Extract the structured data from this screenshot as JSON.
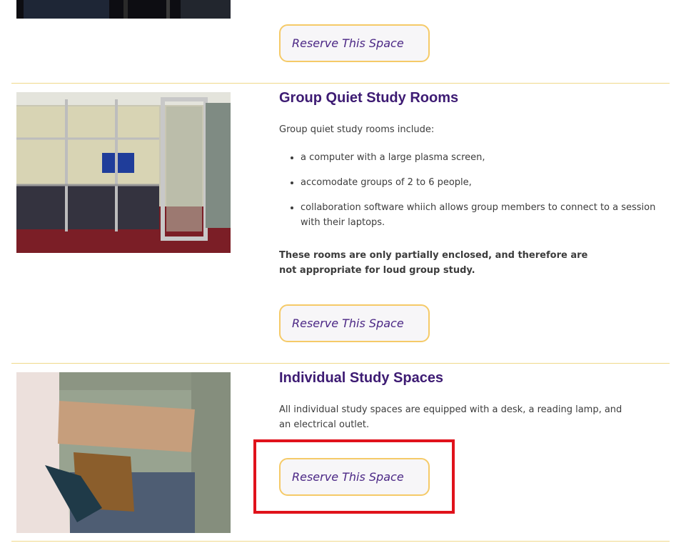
{
  "top_section": {
    "reserve_label": "Reserve This Space"
  },
  "group_room": {
    "title": "Group Quiet Study Rooms",
    "intro": "Group quiet study rooms include:",
    "features": [
      "a computer with a large plasma screen,",
      "accomodate groups of 2 to 6 people,",
      "collaboration software whiich allows group members to connect to a session with their laptops."
    ],
    "note": "These rooms are only partially enclosed, and therefore are not appropriate for loud group study.",
    "reserve_label": "Reserve This Space"
  },
  "individual_space": {
    "title": "Individual Study Spaces",
    "description": "All individual study spaces are equipped with a desk, a reading lamp, and an electrical outlet.",
    "reserve_label": "Reserve This Space"
  },
  "colors": {
    "heading": "#3d1b73",
    "button_text": "#4b2785",
    "button_border": "#f5ca68",
    "divider": "#f0d98a",
    "highlight": "#e0121b"
  }
}
